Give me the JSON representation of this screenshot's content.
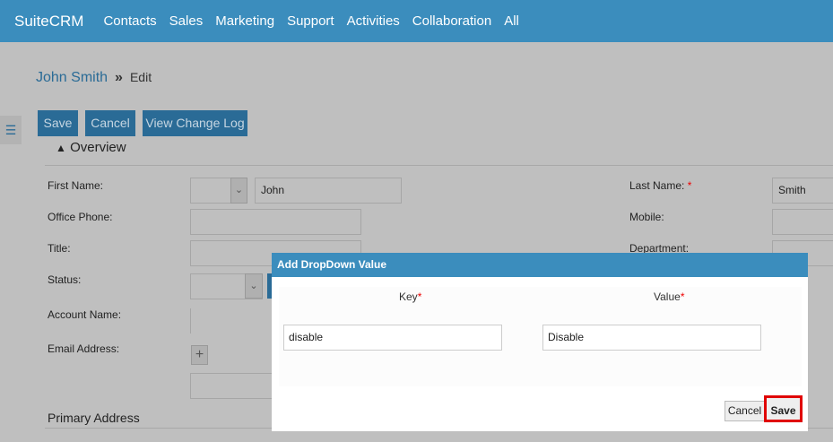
{
  "nav": {
    "brand": "SuiteCRM",
    "items": [
      "Contacts",
      "Sales",
      "Marketing",
      "Support",
      "Activities",
      "Collaboration",
      "All"
    ],
    "color": "#3b8dbd"
  },
  "breadcrumb": {
    "record": "John Smith",
    "separator": "»",
    "action": "Edit"
  },
  "toolbar": {
    "save": "Save",
    "cancel": "Cancel",
    "log": "View Change Log"
  },
  "panel": {
    "title": "Overview",
    "secondary": "Primary Address"
  },
  "form": {
    "first_name_label": "First Name:",
    "first_name": "John",
    "last_name_label": "Last Name:",
    "last_name_req": "*",
    "last_name": "Smith",
    "office_phone_label": "Office Phone:",
    "mobile_label": "Mobile:",
    "title_label": "Title:",
    "department_label": "Department:",
    "status_label": "Status:",
    "account_label": "Account Name:",
    "email_label": "Email Address:"
  },
  "modal": {
    "title": "Add DropDown Value",
    "key_label": "Key",
    "value_label": "Value",
    "req": "*",
    "key": "disable",
    "value": "Disable",
    "cancel": "Cancel",
    "save": "Save",
    "highlight": "#e00000"
  }
}
